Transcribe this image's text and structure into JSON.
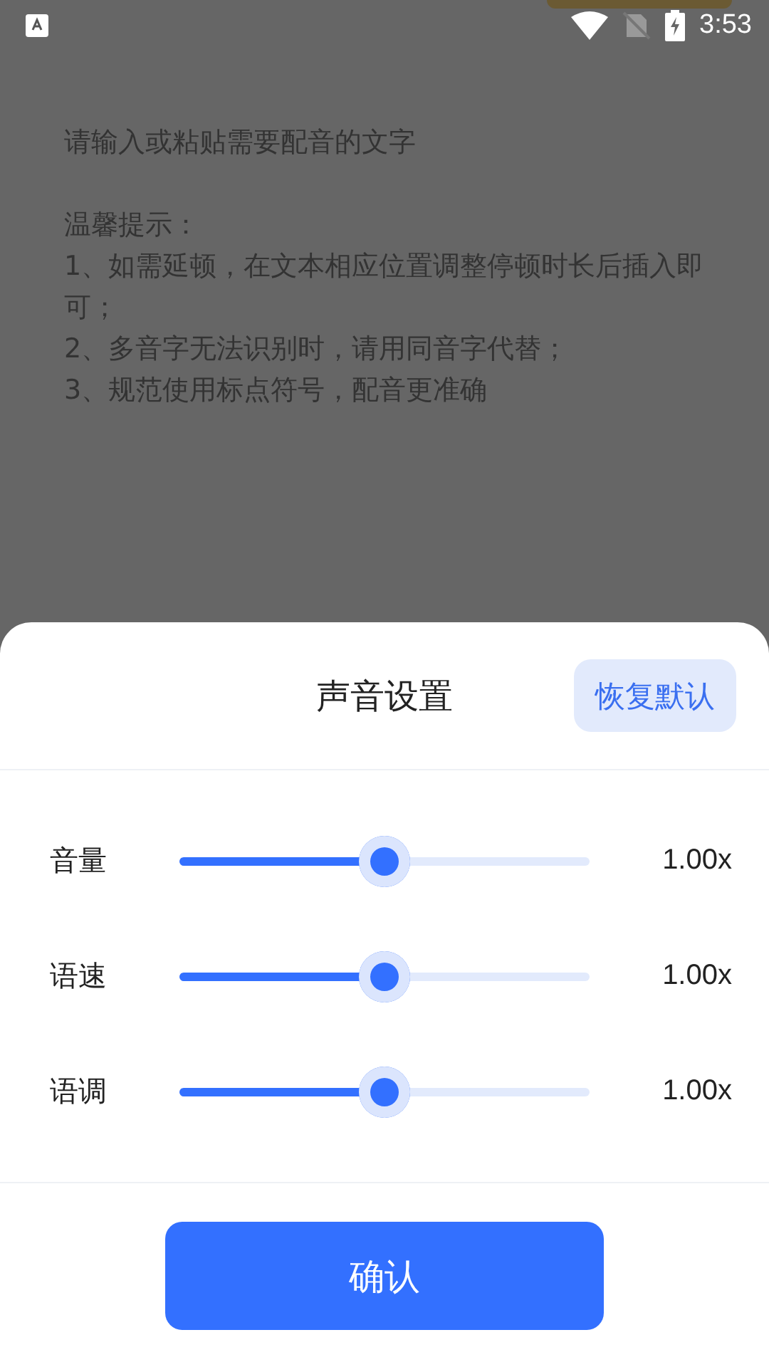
{
  "status_bar": {
    "time": "3:53"
  },
  "background": {
    "placeholder": "请输入或粘贴需要配音的文字",
    "tips": [
      "温馨提示：",
      "1、如需延顿，在文本相应位置调整停顿时长后插入即可；",
      "2、多音字无法识别时，请用同音字代替；",
      "3、规范使用标点符号，配音更准确"
    ]
  },
  "sheet": {
    "title": "声音设置",
    "reset_button": "恢复默认",
    "sliders": [
      {
        "label": "音量",
        "level": 0.5,
        "reading": "1.00x"
      },
      {
        "label": "语速",
        "level": 0.5,
        "reading": "1.00x"
      },
      {
        "label": "语调",
        "level": 0.5,
        "reading": "1.00x"
      }
    ],
    "confirm_button": "确认"
  }
}
